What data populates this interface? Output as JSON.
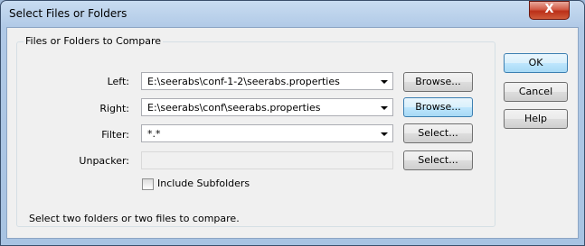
{
  "window": {
    "title": "Select Files or Folders",
    "close_label": "X"
  },
  "group": {
    "title": "Files or Folders to Compare"
  },
  "rows": {
    "left": {
      "label": "Left:",
      "value": "E:\\seerabs\\conf-1-2\\seerabs.properties",
      "button": "Browse..."
    },
    "right": {
      "label": "Right:",
      "value": "E:\\seerabs\\conf\\seerabs.properties",
      "button": "Browse..."
    },
    "filter": {
      "label": "Filter:",
      "value": "*.*",
      "button": "Select..."
    },
    "unpacker": {
      "label": "Unpacker:",
      "value": "",
      "button": "Select..."
    }
  },
  "include_subfolders": {
    "label": "Include Subfolders",
    "checked": false
  },
  "hint": "Select two folders or two files to compare.",
  "side_buttons": {
    "ok": "OK",
    "cancel": "Cancel",
    "help": "Help"
  }
}
